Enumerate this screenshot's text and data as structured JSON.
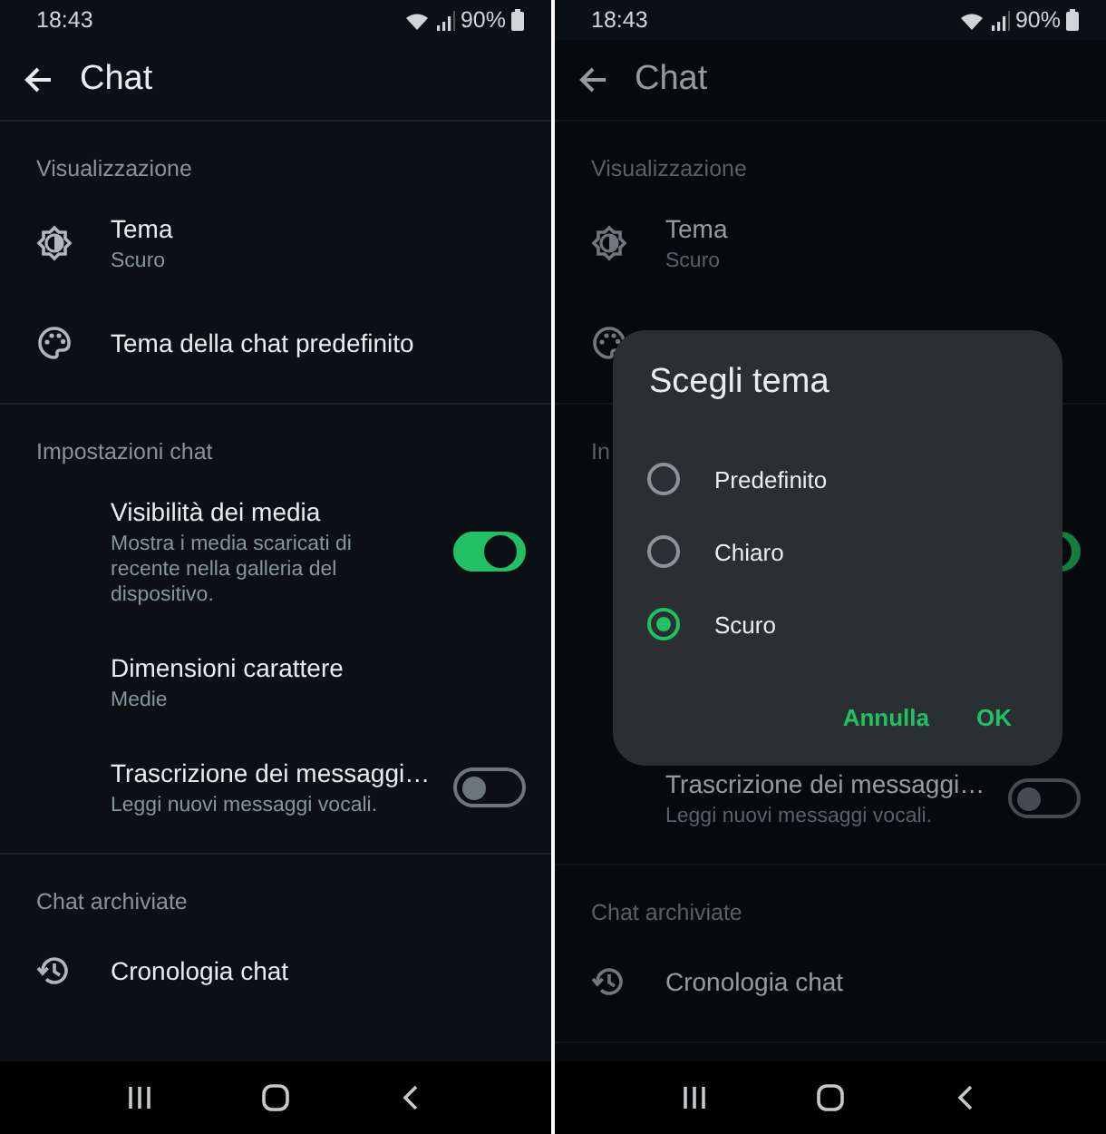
{
  "screens": [
    {
      "status": {
        "time": "18:43",
        "battery": "90%"
      },
      "app_bar": {
        "title": "Chat"
      },
      "sections": [
        {
          "header": "Visualizzazione",
          "rows": [
            {
              "kind": "theme",
              "title": "Tema",
              "subtitle": "Scuro"
            },
            {
              "kind": "palette",
              "title": "Tema della chat predefinito"
            }
          ]
        },
        {
          "header": "Impostazioni chat",
          "rows": [
            {
              "kind": "switch",
              "title": "Visibilità dei media",
              "subtitle": "Mostra i media scaricati di recente nella galleria del dispositivo.",
              "on": true
            },
            {
              "kind": "plain",
              "title": "Dimensioni carattere",
              "subtitle": "Medie"
            },
            {
              "kind": "switch",
              "title": "Trascrizione dei messaggi…",
              "subtitle": "Leggi nuovi messaggi vocali.",
              "on": false
            }
          ]
        },
        {
          "header": "Chat archiviate",
          "rows": [
            {
              "kind": "history",
              "title": "Cronologia chat"
            }
          ]
        }
      ]
    },
    {
      "status": {
        "time": "18:43",
        "battery": "90%"
      },
      "app_bar": {
        "title": "Chat"
      },
      "sections": [
        {
          "header": "Visualizzazione",
          "rows": [
            {
              "kind": "theme",
              "title": "Tema",
              "subtitle": "Scuro"
            },
            {
              "kind": "palette"
            }
          ]
        },
        {
          "header": "In",
          "rows": [
            {
              "kind": "switch",
              "on": true
            },
            {
              "kind": "plain"
            },
            {
              "kind": "switch",
              "title": "Trascrizione dei messaggi…",
              "subtitle": "Leggi nuovi messaggi vocali.",
              "on": false
            }
          ]
        },
        {
          "header": "Chat archiviate",
          "rows": [
            {
              "kind": "history",
              "title": "Cronologia chat"
            }
          ]
        }
      ],
      "dialog": {
        "title": "Scegli tema",
        "options": [
          {
            "label": "Predefinito",
            "selected": false
          },
          {
            "label": "Chiaro",
            "selected": false
          },
          {
            "label": "Scuro",
            "selected": true
          }
        ],
        "buttons": [
          "Annulla",
          "OK"
        ]
      }
    }
  ]
}
